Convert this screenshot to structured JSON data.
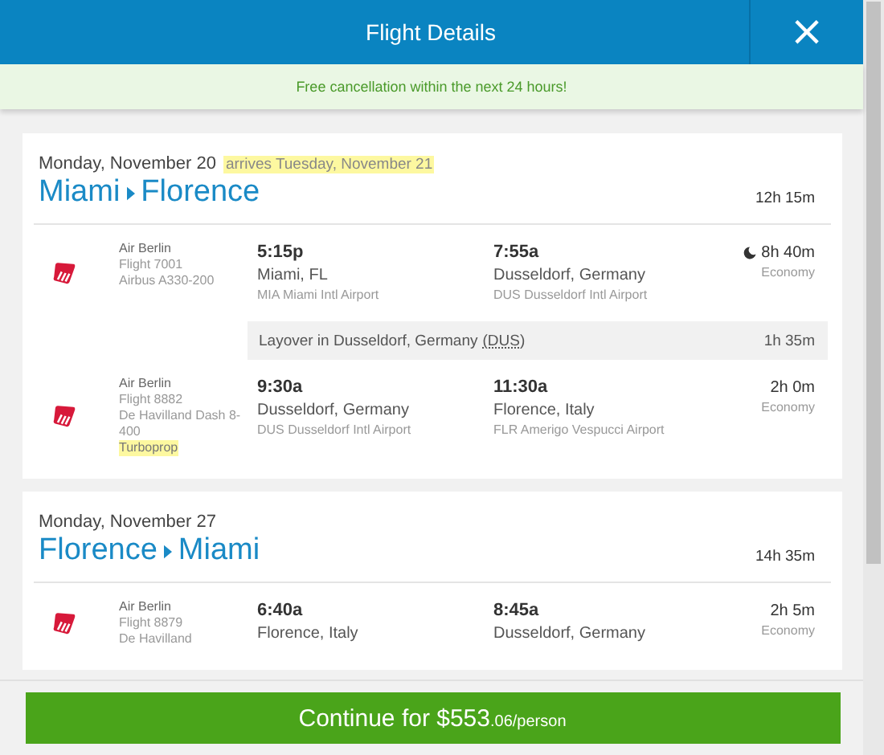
{
  "header": {
    "title": "Flight Details",
    "close": "×"
  },
  "banner": "Free cancellation within the next 24 hours!",
  "legs": [
    {
      "date": "Monday, November 20",
      "arrival_note": "arrives Tuesday, November 21",
      "from": "Miami",
      "to": "Florence",
      "duration": "12h 15m",
      "segments": [
        {
          "kind": "flight",
          "airline": "Air Berlin",
          "flight": "Flight 7001",
          "aircraft": "Airbus A330-200",
          "depart": {
            "time": "5:15p",
            "city": "Miami, FL",
            "airport": "MIA Miami Intl Airport"
          },
          "arrive": {
            "time": "7:55a",
            "city": "Dusseldorf, Germany",
            "airport": "DUS Dusseldorf Intl Airport"
          },
          "duration": "8h 40m",
          "overnight": true,
          "cabin": "Economy"
        },
        {
          "kind": "layover",
          "text": "Layover in Dusseldorf, Germany",
          "code": "(DUS)",
          "duration": "1h 35m"
        },
        {
          "kind": "flight",
          "airline": "Air Berlin",
          "flight": "Flight 8882",
          "aircraft": "De Havilland Dash 8-400",
          "aircraft_note": "Turboprop",
          "depart": {
            "time": "9:30a",
            "city": "Dusseldorf, Germany",
            "airport": "DUS Dusseldorf Intl Airport"
          },
          "arrive": {
            "time": "11:30a",
            "city": "Florence, Italy",
            "airport": "FLR Amerigo Vespucci Airport"
          },
          "duration": "2h 0m",
          "overnight": false,
          "cabin": "Economy"
        }
      ]
    },
    {
      "date": "Monday, November 27",
      "from": "Florence",
      "to": "Miami",
      "duration": "14h 35m",
      "segments": [
        {
          "kind": "flight",
          "airline": "Air Berlin",
          "flight": "Flight 8879",
          "aircraft": "De Havilland",
          "depart": {
            "time": "6:40a",
            "city": "Florence, Italy"
          },
          "arrive": {
            "time": "8:45a",
            "city": "Dusseldorf, Germany"
          },
          "duration": "2h 5m",
          "overnight": false,
          "cabin": "Economy"
        }
      ]
    }
  ],
  "footer": {
    "button": "Continue for $553",
    "button_suffix": ".06/person"
  }
}
